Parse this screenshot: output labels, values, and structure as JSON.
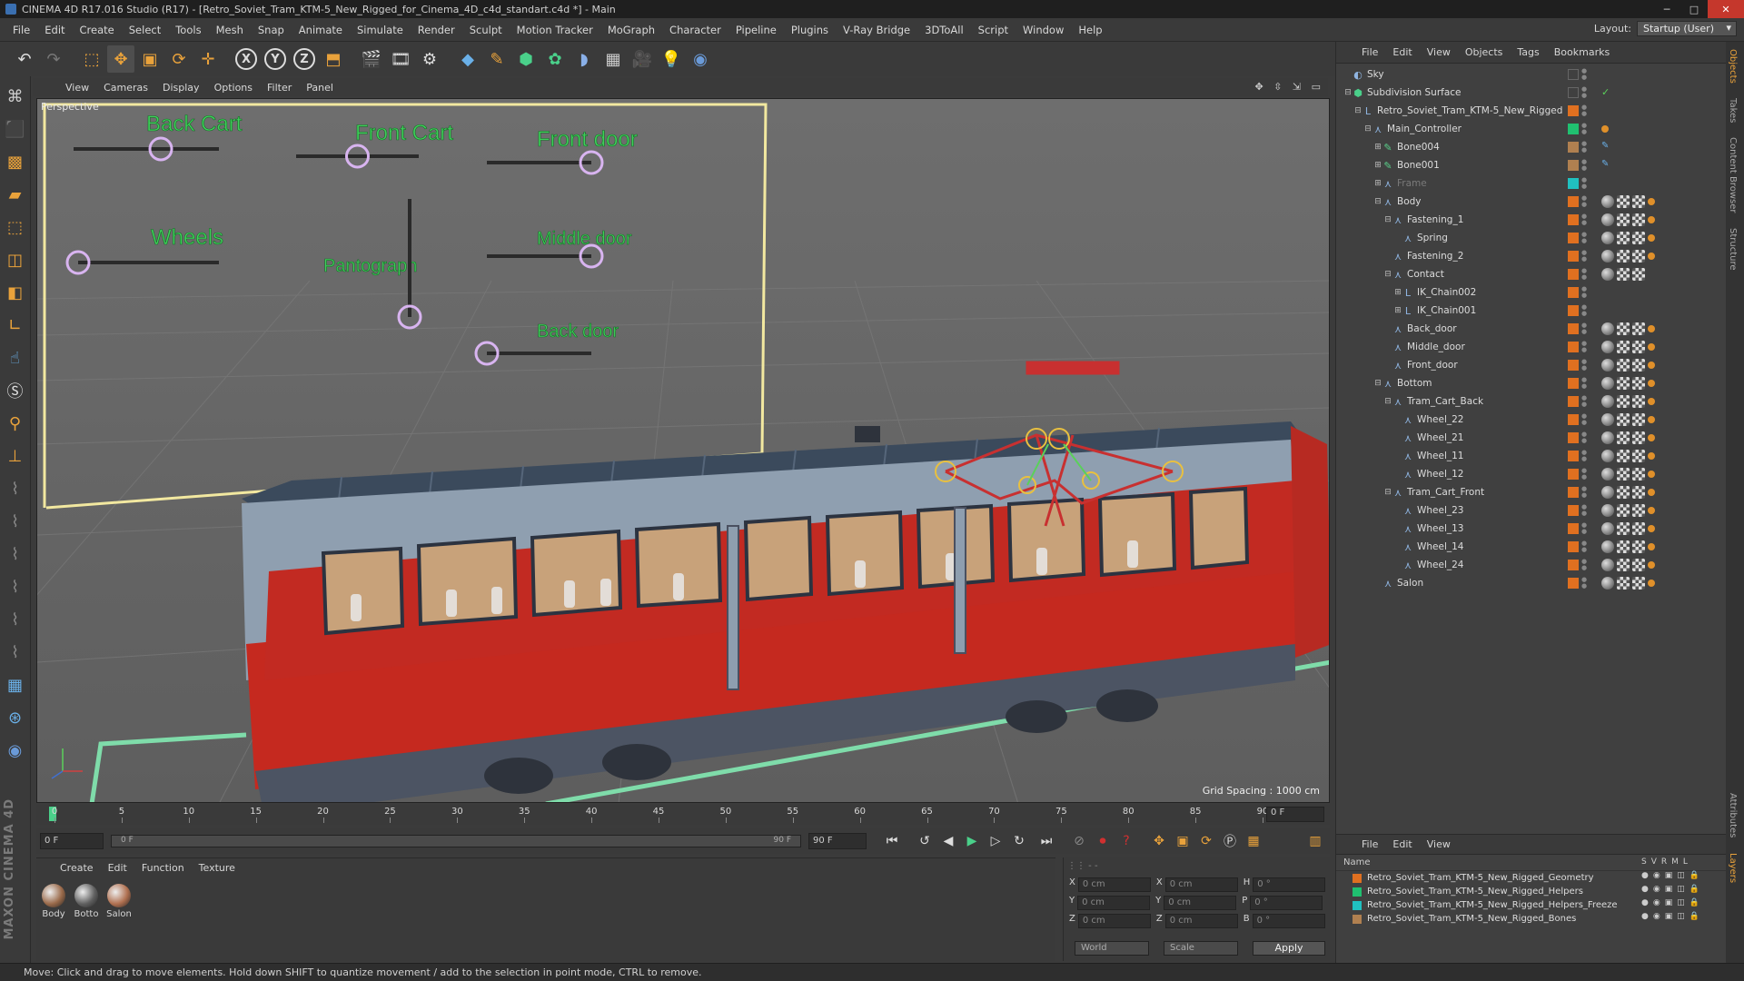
{
  "window": {
    "title": "CINEMA 4D R17.016 Studio (R17) - [Retro_Soviet_Tram_KTM-5_New_Rigged_for_Cinema_4D_c4d_standart.c4d *] - Main"
  },
  "menubar": {
    "items": [
      "File",
      "Edit",
      "Create",
      "Select",
      "Tools",
      "Mesh",
      "Snap",
      "Animate",
      "Simulate",
      "Render",
      "Sculpt",
      "Motion Tracker",
      "MoGraph",
      "Character",
      "Pipeline",
      "Plugins",
      "V-Ray Bridge",
      "3DToAll",
      "Script",
      "Window",
      "Help"
    ],
    "layout_label": "Layout:",
    "layout_value": "Startup (User)"
  },
  "viewport": {
    "menu": [
      "View",
      "Cameras",
      "Display",
      "Options",
      "Filter",
      "Panel"
    ],
    "label": "Perspective",
    "grid_spacing": "Grid Spacing : 1000 cm",
    "controls": [
      {
        "label": "Back Cart",
        "value": 0.6
      },
      {
        "label": "Front Cart",
        "value": 0.5
      },
      {
        "label": "Front door",
        "value": 1.0
      },
      {
        "label": "Wheels",
        "value": 0.0
      },
      {
        "label": "Pantograph",
        "value": 1.0
      },
      {
        "label": "Middle door",
        "value": 1.0
      },
      {
        "label": "Back door",
        "value": 0.0
      }
    ]
  },
  "timeline": {
    "ticks": [
      "0",
      "5",
      "10",
      "15",
      "20",
      "25",
      "30",
      "35",
      "40",
      "45",
      "50",
      "55",
      "60",
      "65",
      "70",
      "75",
      "80",
      "85",
      "90"
    ],
    "current_frame": "0 F"
  },
  "transport": {
    "start": "0 F",
    "range_start": "0 F",
    "range_end": "90 F",
    "end": "90 F"
  },
  "materials": {
    "menu": [
      "Create",
      "Edit",
      "Function",
      "Texture"
    ],
    "items": [
      {
        "name": "Body",
        "color": "#9a6a4a"
      },
      {
        "name": "Botto",
        "color": "#606060"
      },
      {
        "name": "Salon",
        "color": "#b07050"
      }
    ]
  },
  "coordinates": {
    "rows": [
      {
        "a": "X",
        "av": "0 cm",
        "b": "X",
        "bv": "0 cm",
        "c": "H",
        "cv": "0 °"
      },
      {
        "a": "Y",
        "av": "0 cm",
        "b": "Y",
        "bv": "0 cm",
        "c": "P",
        "cv": "0 °"
      },
      {
        "a": "Z",
        "av": "0 cm",
        "b": "Z",
        "bv": "0 cm",
        "c": "B",
        "cv": "0 °"
      }
    ],
    "mode": "World",
    "type": "Scale",
    "apply": "Apply"
  },
  "objects": {
    "menu": [
      "File",
      "Edit",
      "View",
      "Objects",
      "Tags",
      "Bookmarks"
    ],
    "tree": [
      {
        "name": "Sky",
        "depth": 0,
        "expand": "",
        "icon": "sky-icon",
        "color": "",
        "dim": false,
        "tags": []
      },
      {
        "name": "Subdivision Surface",
        "depth": 0,
        "expand": "–",
        "icon": "subdivision-icon",
        "color": "",
        "dim": false,
        "tags": [
          "check"
        ]
      },
      {
        "name": "Retro_Soviet_Tram_KTM-5_New_Rigged",
        "depth": 1,
        "expand": "–",
        "icon": "null-icon",
        "color": "#e07020",
        "dim": false,
        "tags": []
      },
      {
        "name": "Main_Controller",
        "depth": 2,
        "expand": "–",
        "icon": "joint-icon",
        "color": "#20c070",
        "dim": false,
        "tags": [
          "dot"
        ]
      },
      {
        "name": "Bone004",
        "depth": 3,
        "expand": "+",
        "icon": "bone-icon",
        "color": "#b08050",
        "dim": false,
        "tags": [
          "ik"
        ]
      },
      {
        "name": "Bone001",
        "depth": 3,
        "expand": "+",
        "icon": "bone-icon",
        "color": "#b08050",
        "dim": false,
        "tags": [
          "ik"
        ]
      },
      {
        "name": "Frame",
        "depth": 3,
        "expand": "+",
        "icon": "joint-icon",
        "color": "#20c0c0",
        "dim": true,
        "tags": []
      },
      {
        "name": "Body",
        "depth": 3,
        "expand": "–",
        "icon": "joint-icon",
        "color": "#e07020",
        "dim": false,
        "tags": [
          "sph",
          "chk",
          "chk",
          "dot"
        ]
      },
      {
        "name": "Fastening_1",
        "depth": 4,
        "expand": "–",
        "icon": "joint-icon",
        "color": "#e07020",
        "dim": false,
        "tags": [
          "sph",
          "chk",
          "chk",
          "dot"
        ]
      },
      {
        "name": "Spring",
        "depth": 5,
        "expand": "",
        "icon": "joint-icon",
        "color": "#e07020",
        "dim": false,
        "tags": [
          "sph",
          "chk",
          "chk",
          "dot"
        ]
      },
      {
        "name": "Fastening_2",
        "depth": 4,
        "expand": "",
        "icon": "joint-icon",
        "color": "#e07020",
        "dim": false,
        "tags": [
          "sph",
          "chk",
          "chk",
          "dot"
        ]
      },
      {
        "name": "Contact",
        "depth": 4,
        "expand": "–",
        "icon": "joint-icon",
        "color": "#e07020",
        "dim": false,
        "tags": [
          "sph",
          "chk",
          "chk"
        ]
      },
      {
        "name": "IK_Chain002",
        "depth": 5,
        "expand": "+",
        "icon": "null-icon",
        "color": "#e07020",
        "dim": false,
        "tags": []
      },
      {
        "name": "IK_Chain001",
        "depth": 5,
        "expand": "+",
        "icon": "null-icon",
        "color": "#e07020",
        "dim": false,
        "tags": []
      },
      {
        "name": "Back_door",
        "depth": 4,
        "expand": "",
        "icon": "joint-icon",
        "color": "#e07020",
        "dim": false,
        "tags": [
          "sph",
          "chk",
          "chk",
          "dot"
        ]
      },
      {
        "name": "Middle_door",
        "depth": 4,
        "expand": "",
        "icon": "joint-icon",
        "color": "#e07020",
        "dim": false,
        "tags": [
          "sph",
          "chk",
          "chk",
          "dot"
        ]
      },
      {
        "name": "Front_door",
        "depth": 4,
        "expand": "",
        "icon": "joint-icon",
        "color": "#e07020",
        "dim": false,
        "tags": [
          "sph",
          "chk",
          "chk",
          "dot"
        ]
      },
      {
        "name": "Bottom",
        "depth": 3,
        "expand": "–",
        "icon": "joint-icon",
        "color": "#e07020",
        "dim": false,
        "tags": [
          "sph",
          "chk",
          "chk",
          "dot"
        ]
      },
      {
        "name": "Tram_Cart_Back",
        "depth": 4,
        "expand": "–",
        "icon": "joint-icon",
        "color": "#e07020",
        "dim": false,
        "tags": [
          "sph",
          "chk",
          "chk",
          "dot"
        ]
      },
      {
        "name": "Wheel_22",
        "depth": 5,
        "expand": "",
        "icon": "joint-icon",
        "color": "#e07020",
        "dim": false,
        "tags": [
          "sph",
          "chk",
          "chk",
          "dot"
        ]
      },
      {
        "name": "Wheel_21",
        "depth": 5,
        "expand": "",
        "icon": "joint-icon",
        "color": "#e07020",
        "dim": false,
        "tags": [
          "sph",
          "chk",
          "chk",
          "dot"
        ]
      },
      {
        "name": "Wheel_11",
        "depth": 5,
        "expand": "",
        "icon": "joint-icon",
        "color": "#e07020",
        "dim": false,
        "tags": [
          "sph",
          "chk",
          "chk",
          "dot"
        ]
      },
      {
        "name": "Wheel_12",
        "depth": 5,
        "expand": "",
        "icon": "joint-icon",
        "color": "#e07020",
        "dim": false,
        "tags": [
          "sph",
          "chk",
          "chk",
          "dot"
        ]
      },
      {
        "name": "Tram_Cart_Front",
        "depth": 4,
        "expand": "–",
        "icon": "joint-icon",
        "color": "#e07020",
        "dim": false,
        "tags": [
          "sph",
          "chk",
          "chk",
          "dot"
        ]
      },
      {
        "name": "Wheel_23",
        "depth": 5,
        "expand": "",
        "icon": "joint-icon",
        "color": "#e07020",
        "dim": false,
        "tags": [
          "sph",
          "chk",
          "chk",
          "dot"
        ]
      },
      {
        "name": "Wheel_13",
        "depth": 5,
        "expand": "",
        "icon": "joint-icon",
        "color": "#e07020",
        "dim": false,
        "tags": [
          "sph",
          "chk",
          "chk",
          "dot"
        ]
      },
      {
        "name": "Wheel_14",
        "depth": 5,
        "expand": "",
        "icon": "joint-icon",
        "color": "#e07020",
        "dim": false,
        "tags": [
          "sph",
          "chk",
          "chk",
          "dot"
        ]
      },
      {
        "name": "Wheel_24",
        "depth": 5,
        "expand": "",
        "icon": "joint-icon",
        "color": "#e07020",
        "dim": false,
        "tags": [
          "sph",
          "chk",
          "chk",
          "dot"
        ]
      },
      {
        "name": "Salon",
        "depth": 3,
        "expand": "",
        "icon": "joint-icon",
        "color": "#e07020",
        "dim": false,
        "tags": [
          "sph",
          "chk",
          "chk",
          "dot"
        ]
      }
    ]
  },
  "layers": {
    "menu": [
      "File",
      "Edit",
      "View"
    ],
    "header": {
      "name": "Name",
      "flags": [
        "S",
        "V",
        "R",
        "M",
        "L"
      ]
    },
    "items": [
      {
        "name": "Retro_Soviet_Tram_KTM-5_New_Rigged_Geometry",
        "color": "#e07020"
      },
      {
        "name": "Retro_Soviet_Tram_KTM-5_New_Rigged_Helpers",
        "color": "#20c070"
      },
      {
        "name": "Retro_Soviet_Tram_KTM-5_New_Rigged_Helpers_Freeze",
        "color": "#20c0c0"
      },
      {
        "name": "Retro_Soviet_Tram_KTM-5_New_Rigged_Bones",
        "color": "#b08050"
      }
    ]
  },
  "sidetabs": [
    "Objects",
    "Takes",
    "Content Browser",
    "Structure"
  ],
  "sidetabs_bottom": [
    "Attributes",
    "Layers"
  ],
  "status": "Move: Click and drag to move elements. Hold down SHIFT to quantize movement / add to the selection in point mode, CTRL to remove."
}
